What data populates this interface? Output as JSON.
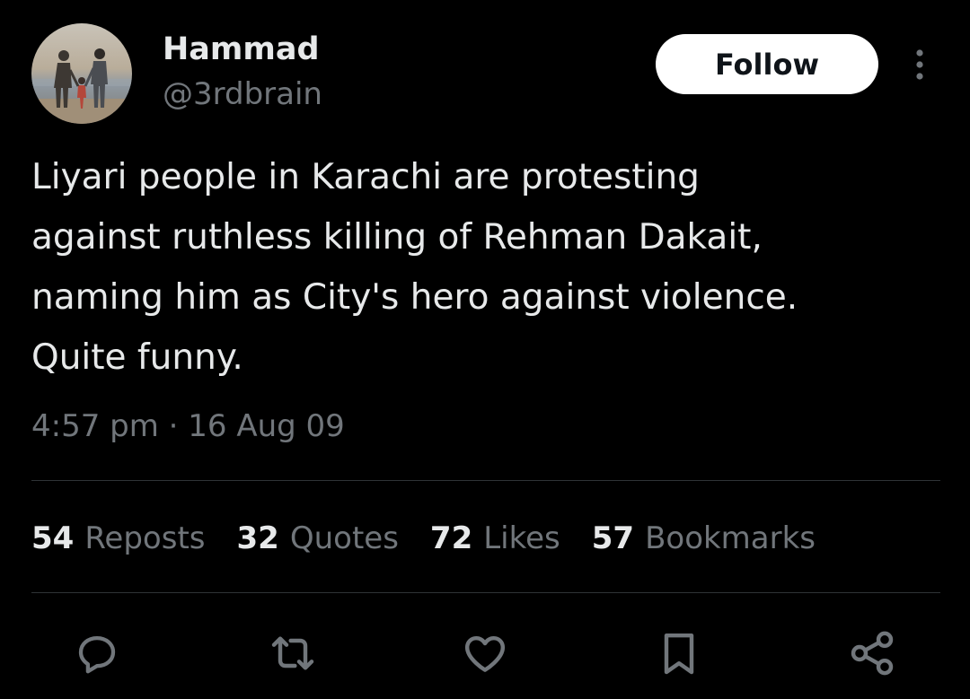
{
  "tweet": {
    "author": {
      "display_name": "Hammad",
      "handle": "@3rdbrain",
      "avatar_icon": "avatar-photo"
    },
    "follow_label": "Follow",
    "more_icon": "more-vertical-icon",
    "text": "Liyari people in Karachi are protesting\nagainst ruthless killing of Rehman Dakait,\nnaming him as City's hero against violence.\nQuite funny.",
    "timestamp": "4:57 pm · 16 Aug 09",
    "stats": [
      {
        "count": "54",
        "label": "Reposts"
      },
      {
        "count": "32",
        "label": "Quotes"
      },
      {
        "count": "72",
        "label": "Likes"
      },
      {
        "count": "57",
        "label": "Bookmarks"
      }
    ],
    "actions": [
      "reply-icon",
      "repost-icon",
      "like-icon",
      "bookmark-icon",
      "share-icon"
    ]
  },
  "colors": {
    "background": "#000000",
    "text_primary": "#e7e9ea",
    "text_secondary": "#71767b",
    "divider": "#2f3336",
    "follow_button_bg": "#ffffff",
    "follow_button_text": "#0f1419"
  }
}
